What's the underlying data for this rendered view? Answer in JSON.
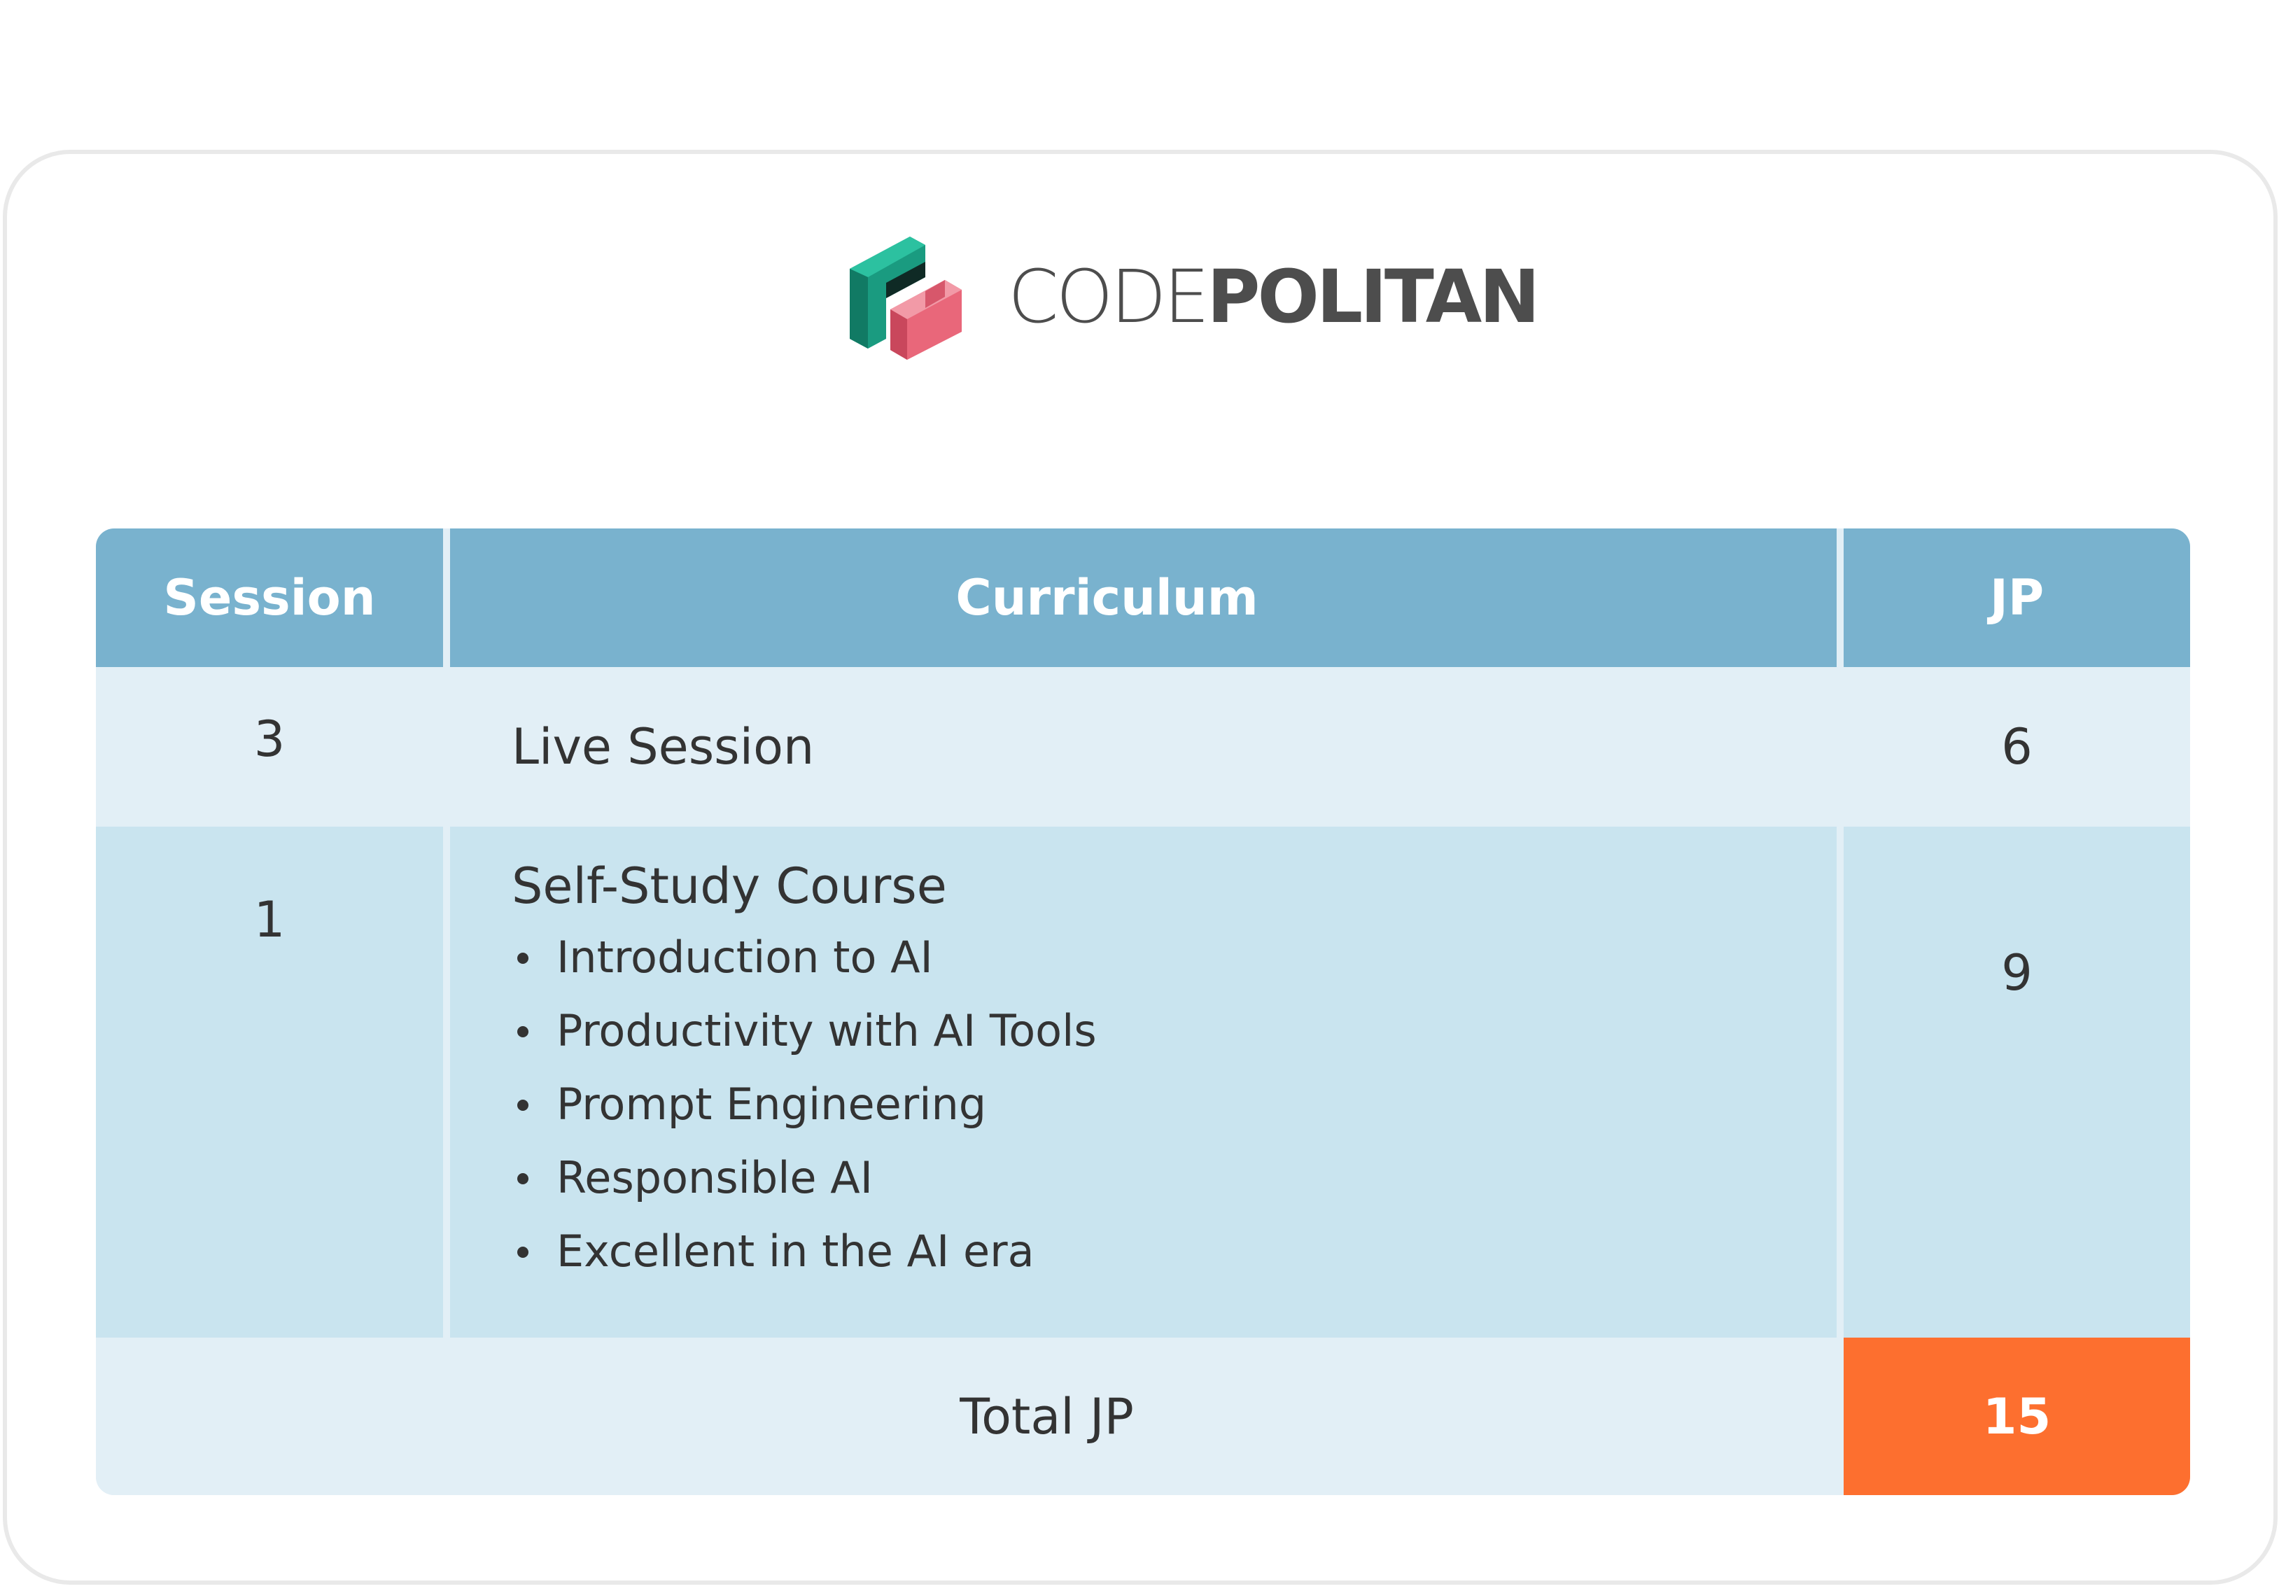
{
  "brand": {
    "name_light": "CODE",
    "name_bold": "POLITAN",
    "colors": {
      "green": "#1a9b80",
      "pink": "#e9677a",
      "text": "#4d4d4d"
    }
  },
  "table": {
    "headers": {
      "session": "Session",
      "curriculum": "Curriculum",
      "jp": "JP"
    },
    "rows": [
      {
        "session": "3",
        "title": "Live Session",
        "items": [],
        "jp": "6"
      },
      {
        "session": "1",
        "title": "Self-Study Course",
        "items": [
          "Introduction to AI",
          "Productivity with AI Tools",
          "Prompt Engineering",
          "Responsible AI",
          "Excellent in the AI era"
        ],
        "jp": "9"
      }
    ],
    "total_label": "Total JP",
    "total_value": "15"
  },
  "colors": {
    "header_bg": "#79b2ce",
    "row1_bg": "#e2eff6",
    "row2_bg": "#c9e4ef",
    "total_bg": "#fd6f2f"
  }
}
